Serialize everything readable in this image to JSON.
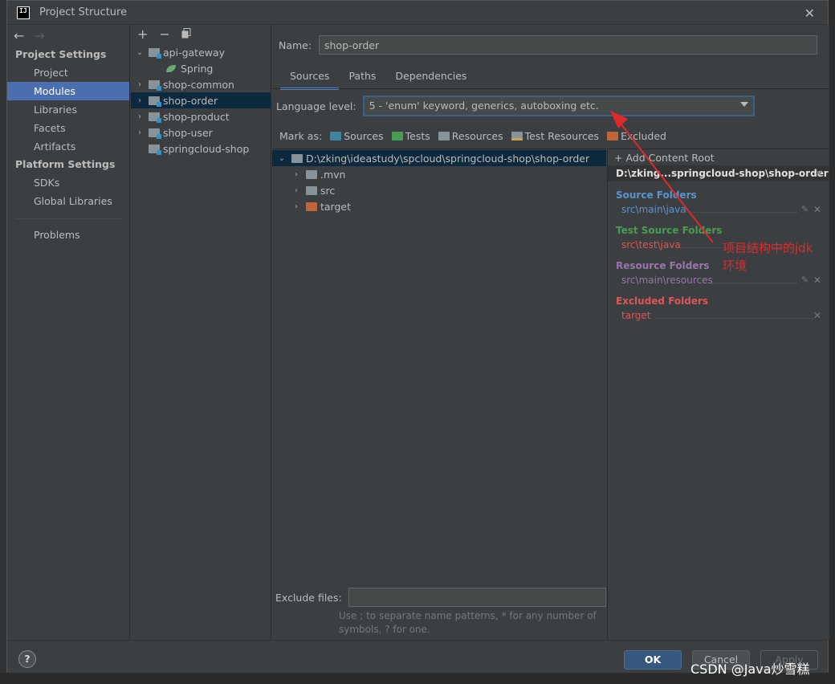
{
  "window": {
    "title": "Project Structure",
    "app_logo_text": "IJ"
  },
  "nav": {
    "back_icon": "arrow-left",
    "forward_icon": "arrow-right",
    "project_settings_header": "Project Settings",
    "project_settings_items": [
      "Project",
      "Modules",
      "Libraries",
      "Facets",
      "Artifacts"
    ],
    "platform_settings_header": "Platform Settings",
    "platform_settings_items": [
      "SDKs",
      "Global Libraries"
    ],
    "problems": "Problems",
    "selected": "Modules"
  },
  "modules": {
    "toolbar": {
      "add": "+",
      "remove": "−",
      "copy": "copy-icon"
    },
    "tree": [
      {
        "label": "api-gateway",
        "expanded": true
      },
      {
        "label": "Spring",
        "child": true
      },
      {
        "label": "shop-common",
        "expanded": false
      },
      {
        "label": "shop-order",
        "expanded": false,
        "selected": true
      },
      {
        "label": "shop-product",
        "expanded": false
      },
      {
        "label": "shop-user",
        "expanded": false
      },
      {
        "label": "springcloud-shop"
      }
    ]
  },
  "main": {
    "name_label": "Name:",
    "name_value": "shop-order",
    "tabs": [
      "Sources",
      "Paths",
      "Dependencies"
    ],
    "active_tab": "Sources",
    "language_level_label": "Language level:",
    "language_level_value": "5 - 'enum' keyword, generics, autoboxing etc.",
    "mark_as_label": "Mark as:",
    "mark_as": [
      {
        "label": "Sources",
        "color": "#3e86a0"
      },
      {
        "label": "Tests",
        "color": "#499c54"
      },
      {
        "label": "Resources",
        "color": "#87939a"
      },
      {
        "label": "Test Resources",
        "color": "#87939a"
      },
      {
        "label": "Excluded",
        "color": "#c75450"
      }
    ],
    "content_tree": {
      "root": "D:\\zking\\ideastudy\\spcloud\\springcloud-shop\\shop-order",
      "children": [
        ".mvn",
        "src",
        "target"
      ]
    },
    "exclude_files_label": "Exclude files:",
    "exclude_files_value": "",
    "exclude_hint_line1": "Use ; to separate name patterns, * for any number of",
    "exclude_hint_line2": "symbols, ? for one."
  },
  "content_root": {
    "add_label": "+ Add Content Root",
    "header": "D:\\zking...springcloud-shop\\shop-order",
    "groups": [
      {
        "title": "Source Folders",
        "color": "#5994ce",
        "path": "src\\main\\java",
        "path_color": "#5994ce",
        "editable": true
      },
      {
        "title": "Test Source Folders",
        "color": "#499c54",
        "path": "src\\test\\java",
        "path_color": "#e05555",
        "editable": false
      },
      {
        "title": "Resource Folders",
        "color": "#9876aa",
        "path": "src\\main\\resources",
        "path_color": "#9876aa",
        "editable": true
      },
      {
        "title": "Excluded Folders",
        "color": "#e05555",
        "path": "target",
        "path_color": "#e05555",
        "editable": false
      }
    ]
  },
  "footer": {
    "help": "?",
    "ok": "OK",
    "cancel": "Cancel",
    "apply": "Apply"
  },
  "annotation": {
    "line1": "项目结构中的jdk",
    "line2": "环境",
    "color": "#e02a2a"
  },
  "watermark": "CSDN @Java炒雪糕"
}
